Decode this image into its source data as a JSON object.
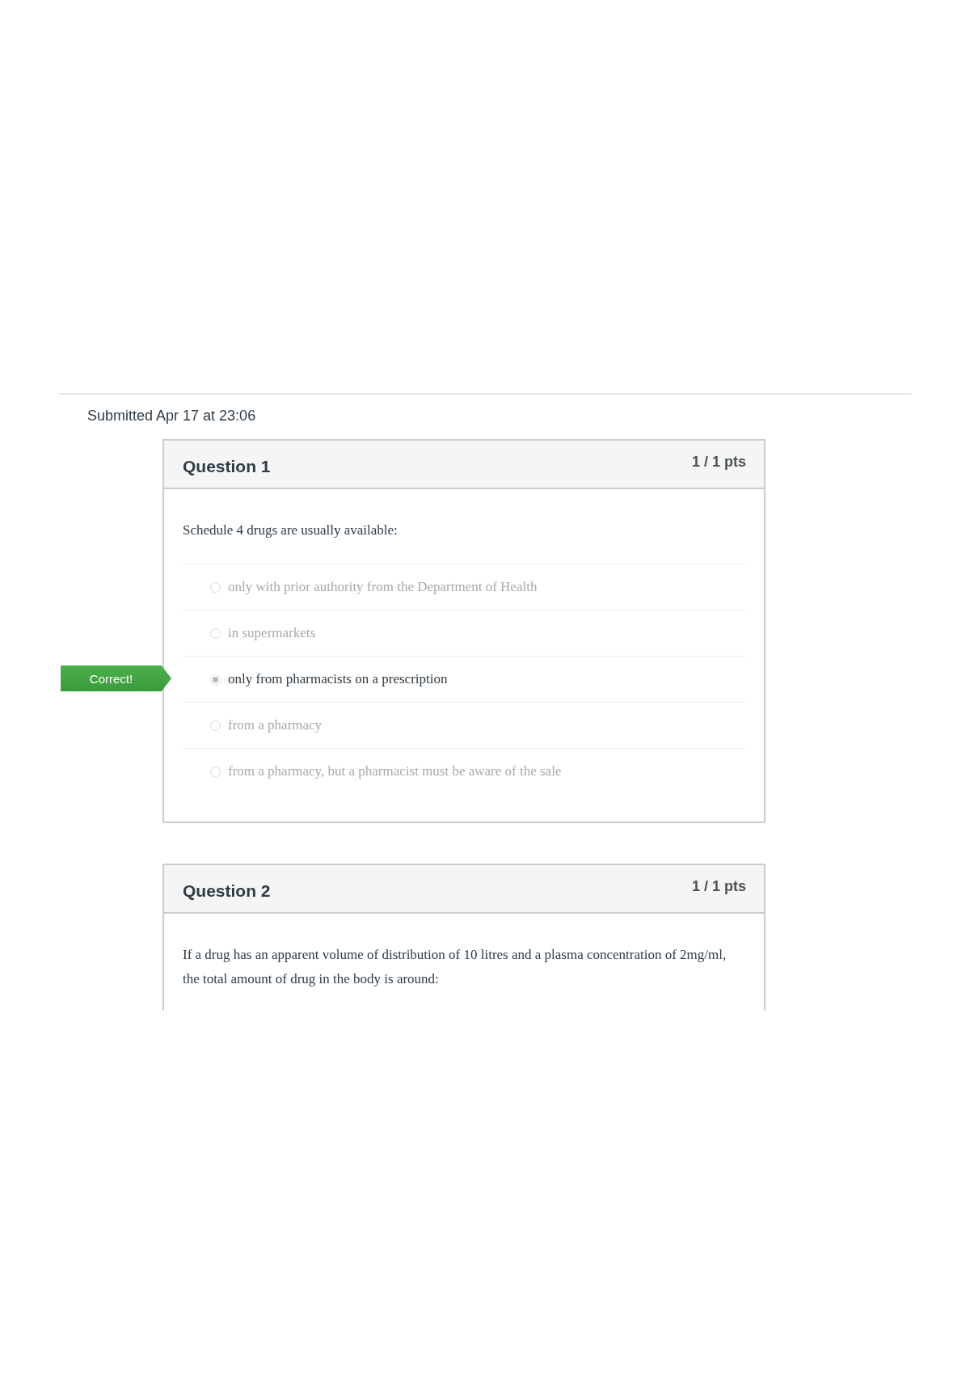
{
  "submission": "Submitted Apr 17 at 23:06",
  "questions": [
    {
      "title": "Question 1",
      "points": "1 / 1 pts",
      "text": "Schedule 4 drugs are usually available:",
      "cut_off": false,
      "answers": [
        {
          "text": "only with prior authority from the Department of Health",
          "selected": false
        },
        {
          "text": "in supermarkets",
          "selected": false
        },
        {
          "text": "only from pharmacists on a prescription",
          "selected": true,
          "flag": "Correct!"
        },
        {
          "text": "from a pharmacy",
          "selected": false
        },
        {
          "text": "from a pharmacy, but a pharmacist must be aware of the sale",
          "selected": false
        }
      ]
    },
    {
      "title": "Question 2",
      "points": "1 / 1 pts",
      "text": "If a drug has an apparent volume of distribution of 10 litres and a plasma concentration of 2mg/ml, the total amount of drug in the body is around:",
      "cut_off": true
    }
  ]
}
